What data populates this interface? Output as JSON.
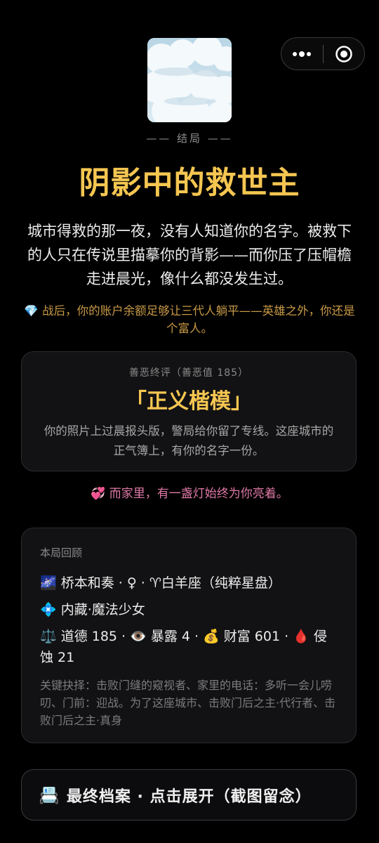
{
  "capsule": {
    "more_icon": "three-dots-icon",
    "close_icon": "target-circle-icon"
  },
  "cover": {
    "description_icon": "cloud-sky-image"
  },
  "ending": {
    "tag": "—— 结局 ——",
    "title": "阴影中的救世主",
    "narrative": "城市得救的那一夜，没有人知道你的名字。被救下的人只在传说里描摹你的背影——而你压了压帽檐走进晨光，像什么都没发生过。",
    "wealth_note": "💎 战后，你的账户余额足够让三代人躺平——英雄之外，你还是个富人。"
  },
  "verdict": {
    "subtitle": "善恶终评（善恶值 185）",
    "title": "「正义楷模」",
    "description": "你的照片上过晨报头版，警局给你留了专线。这座城市的正气簿上，有你的名字一份。"
  },
  "family_note": "💞 而家里，有一盏灯始终为你亮着。",
  "recap": {
    "heading": "本局回顾",
    "identity": "🌌 桥本和奏 · ♀ · ♈白羊座（纯粹星盘）",
    "hidden_role": "💠 内藏·魔法少女",
    "stats": "⚖️ 道德 185 · 👁️ 暴露 4 · 💰 财富 601 · 🩸 侵蚀 21",
    "choices": "关键抉择：击败门缝的窥视者、家里的电话：多听一会儿唠叨、门前：迎战。为了这座城市、击败门后之主·代行者、击败门后之主·真身"
  },
  "archive_button": {
    "icon": "📇",
    "label": "最终档案 · 点击展开（截图留念）"
  },
  "colors": {
    "accent_gold": "#f5c651",
    "wealth_gold": "#c99a46",
    "family_pink": "#e07aa6",
    "background": "#000000",
    "card": "#121214"
  }
}
